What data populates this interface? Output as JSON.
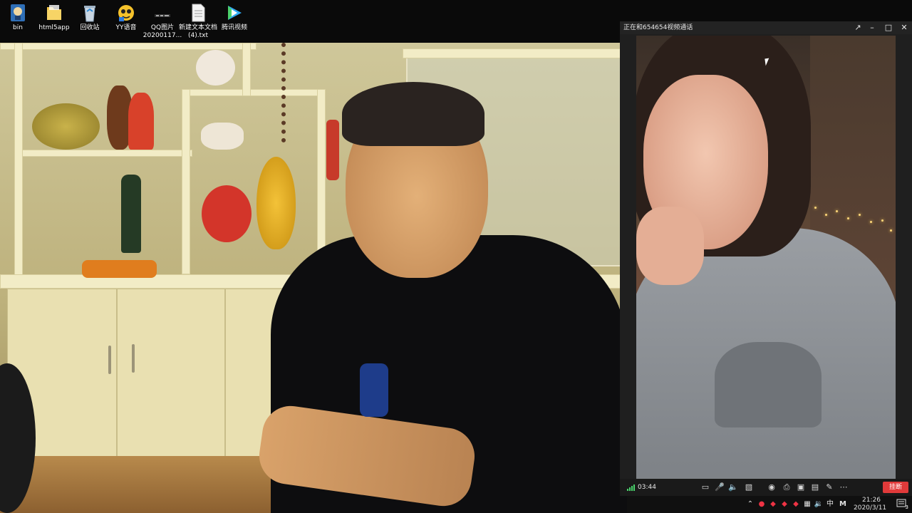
{
  "desktop": {
    "icons": [
      {
        "label": "bin",
        "icon": "bin-shortcut-icon"
      },
      {
        "label": "html5app",
        "icon": "folder-icon"
      },
      {
        "label": "回收站",
        "icon": "recycle-bin-icon"
      },
      {
        "label": "YY语音",
        "icon": "yy-voice-icon"
      },
      {
        "label": "QQ图片",
        "label2": "20200117...",
        "icon": "image-file-icon"
      },
      {
        "label": "新建文本文档",
        "label2": "(4).txt",
        "icon": "text-file-icon"
      },
      {
        "label": "腾讯视频",
        "icon": "tencent-video-icon"
      }
    ]
  },
  "call": {
    "title": "正在和654654视频通话",
    "timer": "03:44",
    "hangup_label": "挂断",
    "toolbar_icons": [
      "chat-icon",
      "microphone-icon",
      "speaker-icon",
      "camera-off-icon",
      "snapshot-icon",
      "printer-icon",
      "screen-share-icon",
      "layout-icon",
      "edit-icon",
      "more-icon"
    ]
  },
  "tray": {
    "ime": "中",
    "time": "21:26",
    "date": "2020/3/11",
    "notification_count": "3"
  },
  "colors": {
    "hangup": "#e03a3a",
    "signal": "#49d36b",
    "titlebar": "#232323"
  }
}
